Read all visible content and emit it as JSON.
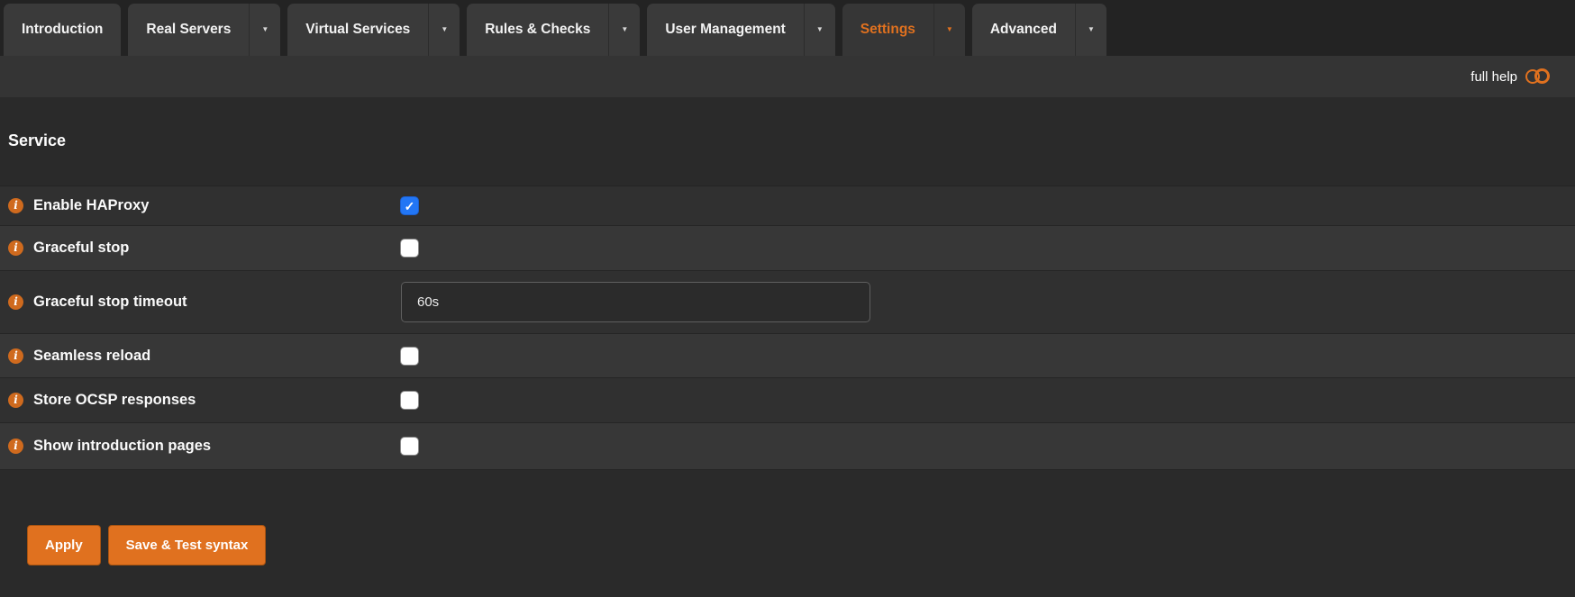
{
  "tabs": [
    {
      "label": "Introduction",
      "has_dropdown": false,
      "active": false
    },
    {
      "label": "Real Servers",
      "has_dropdown": true,
      "active": false
    },
    {
      "label": "Virtual Services",
      "has_dropdown": true,
      "active": false
    },
    {
      "label": "Rules & Checks",
      "has_dropdown": true,
      "active": false
    },
    {
      "label": "User Management",
      "has_dropdown": true,
      "active": false
    },
    {
      "label": "Settings",
      "has_dropdown": true,
      "active": true
    },
    {
      "label": "Advanced",
      "has_dropdown": true,
      "active": false
    }
  ],
  "help_bar": {
    "full_help_label": "full help"
  },
  "section": {
    "title": "Service"
  },
  "form": {
    "rows": [
      {
        "label": "Enable HAProxy",
        "type": "checkbox",
        "checked": true
      },
      {
        "label": "Graceful stop",
        "type": "checkbox",
        "checked": false
      },
      {
        "label": "Graceful stop timeout",
        "type": "text",
        "value": "60s"
      },
      {
        "label": "Seamless reload",
        "type": "checkbox",
        "checked": false
      },
      {
        "label": "Store OCSP responses",
        "type": "checkbox",
        "checked": false
      },
      {
        "label": "Show introduction pages",
        "type": "checkbox",
        "checked": false
      }
    ]
  },
  "buttons": [
    {
      "label": "Apply"
    },
    {
      "label": "Save & Test syntax"
    }
  ],
  "icons": {
    "info": "info-icon",
    "caret": "chevron-down-icon",
    "toggle": "toggle-icon"
  },
  "colors": {
    "accent_orange": "#e0711f",
    "checkbox_checked_blue": "#2276f5",
    "tab_background": "#3a3a3a",
    "page_background": "#2a2a2a"
  }
}
